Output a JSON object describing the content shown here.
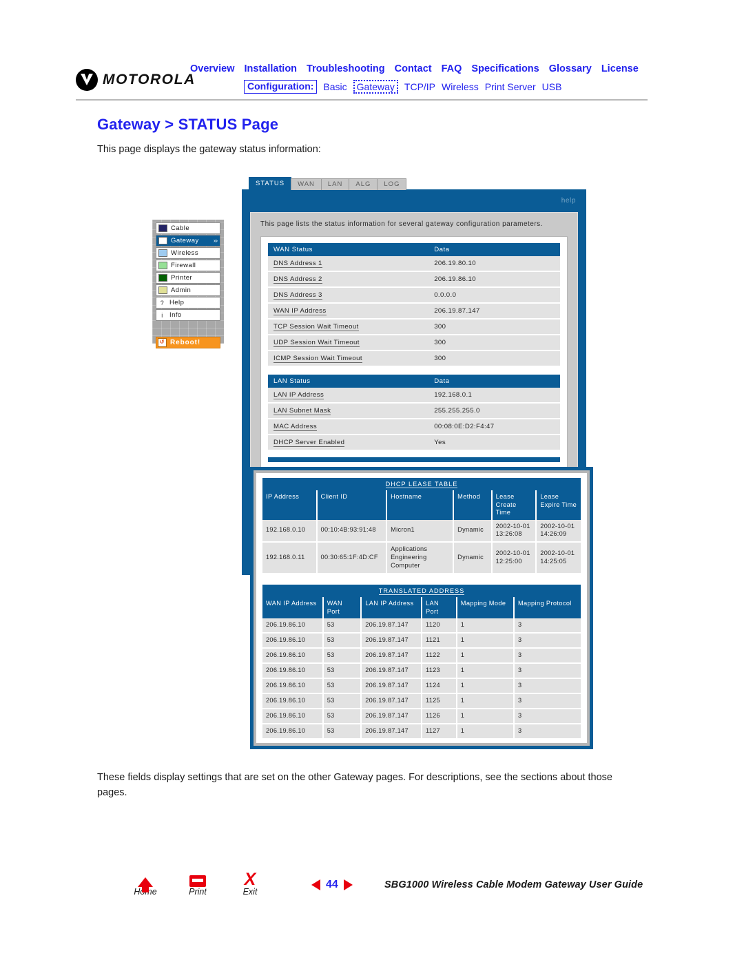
{
  "brand": {
    "name": "MOTOROLA"
  },
  "topnav": {
    "primary": [
      "Overview",
      "Installation",
      "Troubleshooting",
      "Contact",
      "FAQ",
      "Specifications",
      "Glossary",
      "License"
    ],
    "config_label": "Configuration:",
    "secondary": [
      "Basic",
      "Gateway",
      "TCP/IP",
      "Wireless",
      "Print Server",
      "USB"
    ],
    "secondary_active": "Gateway"
  },
  "page": {
    "title": "Gateway > STATUS Page",
    "intro": "This page displays the gateway status information:",
    "outro": "These fields display settings that are set on the other Gateway pages. For descriptions, see the sections about those pages."
  },
  "device": {
    "tabs": [
      "STATUS",
      "WAN",
      "LAN",
      "ALG",
      "LOG"
    ],
    "active_tab": "STATUS",
    "help_label": "help",
    "intro": "This page lists the status information for several gateway configuration parameters.",
    "sidebar": {
      "items": [
        {
          "label": "Cable",
          "swatch": "#242465",
          "selected": false
        },
        {
          "label": "Gateway",
          "swatch": "#ffffff",
          "selected": true,
          "arrows": "»›"
        },
        {
          "label": "Wireless",
          "swatch": "#9ecbf0",
          "selected": false
        },
        {
          "label": "Firewall",
          "swatch": "#96e096",
          "selected": false
        },
        {
          "label": "Printer",
          "swatch": "#046104",
          "selected": false
        },
        {
          "label": "Admin",
          "swatch": "#e0e096",
          "selected": false
        },
        {
          "label": "Help",
          "glyph": "?",
          "selected": false
        },
        {
          "label": "Info",
          "glyph": "i",
          "selected": false
        }
      ],
      "reboot_label": "Reboot!",
      "reboot_glyph": "↺"
    },
    "wan_status": {
      "headers": [
        "WAN Status",
        "Data"
      ],
      "rows": [
        [
          "DNS Address 1",
          "206.19.80.10"
        ],
        [
          "DNS Address 2",
          "206.19.86.10"
        ],
        [
          "DNS Address 3",
          "0.0.0.0"
        ],
        [
          "WAN IP Address",
          "206.19.87.147"
        ],
        [
          "TCP Session Wait Timeout",
          "300"
        ],
        [
          "UDP Session Wait Timeout",
          "300"
        ],
        [
          "ICMP Session Wait Timeout",
          "300"
        ]
      ]
    },
    "lan_status": {
      "headers": [
        "LAN Status",
        "Data"
      ],
      "rows": [
        [
          "LAN IP Address",
          "192.168.0.1"
        ],
        [
          "LAN Subnet Mask",
          "255.255.255.0"
        ],
        [
          "MAC Address",
          "00:08:0E:D2:F4:47"
        ],
        [
          "DHCP Server Enabled",
          "Yes"
        ]
      ]
    },
    "dhcp_lease_table": {
      "title": "DHCP LEASE TABLE",
      "headers": [
        "IP Address",
        "Client ID",
        "Hostname",
        "Method",
        "Lease Create Time",
        "Lease Expire Time"
      ],
      "rows": [
        [
          "192.168.0.10",
          "00:10:4B:93:91:48",
          "Micron1",
          "Dynamic",
          "2002-10-01 13:26:08",
          "2002-10-01 14:26:09"
        ],
        [
          "192.168.0.11",
          "00:30:65:1F:4D:CF",
          "Applications Engineering Computer",
          "Dynamic",
          "2002-10-01 12:25:00",
          "2002-10-01 14:25:05"
        ]
      ]
    },
    "translated_address": {
      "title": "TRANSLATED ADDRESS",
      "headers": [
        "WAN IP Address",
        "WAN Port",
        "LAN IP Address",
        "LAN Port",
        "Mapping Mode",
        "Mapping Protocol"
      ],
      "rows": [
        [
          "206.19.86.10",
          "53",
          "206.19.87.147",
          "1120",
          "1",
          "3"
        ],
        [
          "206.19.86.10",
          "53",
          "206.19.87.147",
          "1121",
          "1",
          "3"
        ],
        [
          "206.19.86.10",
          "53",
          "206.19.87.147",
          "1122",
          "1",
          "3"
        ],
        [
          "206.19.86.10",
          "53",
          "206.19.87.147",
          "1123",
          "1",
          "3"
        ],
        [
          "206.19.86.10",
          "53",
          "206.19.87.147",
          "1124",
          "1",
          "3"
        ],
        [
          "206.19.86.10",
          "53",
          "206.19.87.147",
          "1125",
          "1",
          "3"
        ],
        [
          "206.19.86.10",
          "53",
          "206.19.87.147",
          "1126",
          "1",
          "3"
        ],
        [
          "206.19.86.10",
          "53",
          "206.19.87.147",
          "1127",
          "1",
          "3"
        ]
      ]
    }
  },
  "footer": {
    "buttons": [
      {
        "label": "Home",
        "icon": "home-icon"
      },
      {
        "label": "Print",
        "icon": "printer-icon"
      },
      {
        "label": "Exit",
        "icon": "exit-x-icon"
      }
    ],
    "page_number": "44",
    "guide_title": "SBG1000 Wireless Cable Modem Gateway User Guide"
  },
  "colors": {
    "link_blue": "#2222ee",
    "device_blue": "#0a5c96",
    "accent_red": "#e8000d",
    "reboot_orange": "#f7941e"
  }
}
